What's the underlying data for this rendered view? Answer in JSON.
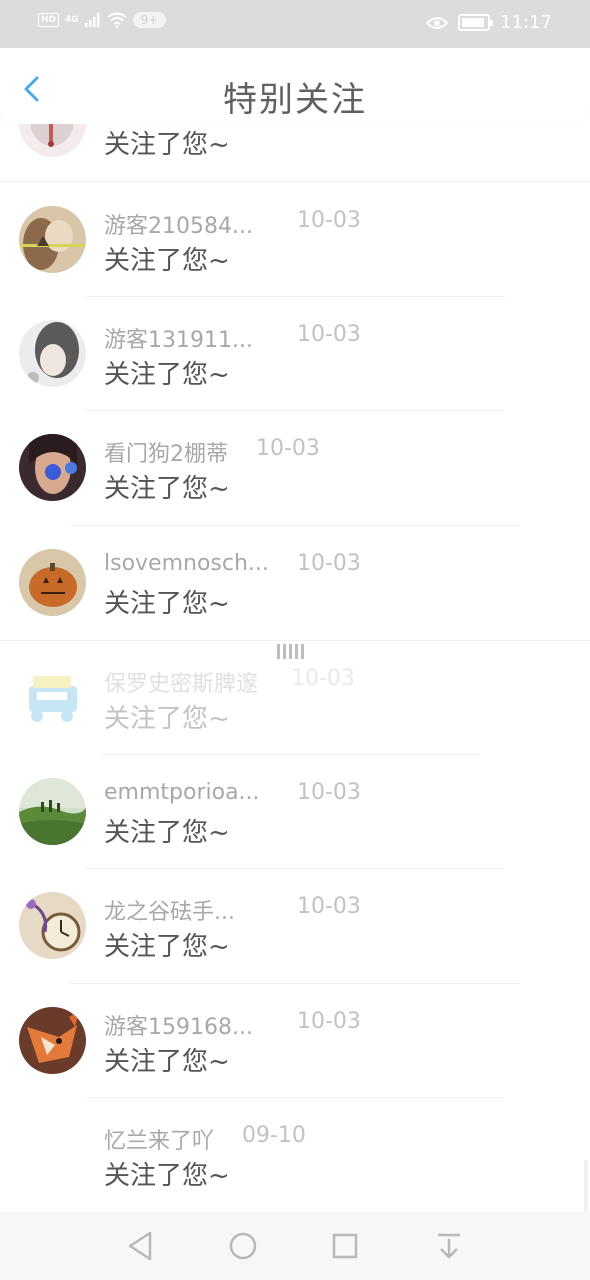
{
  "status_bar": {
    "hd": "HD",
    "network": "4G",
    "notification_count": "9+",
    "time": "11:17"
  },
  "header": {
    "title": "特别关注"
  },
  "list": {
    "items": [
      {
        "name": "",
        "date": "",
        "message": "关注了您~"
      },
      {
        "name": "游客210584...",
        "date": "10-03",
        "message": "关注了您~"
      },
      {
        "name": "游客131911...",
        "date": "10-03",
        "message": "关注了您~"
      },
      {
        "name": "看门狗2棚蒂",
        "date": "10-03",
        "message": "关注了您~"
      },
      {
        "name": "lsovemnosch...",
        "date": "10-03",
        "message": "关注了您~"
      },
      {
        "name": "保罗史密斯脾邃",
        "date": "10-03",
        "message": "关注了您~"
      },
      {
        "name": "emmtporioa...",
        "date": "10-03",
        "message": "关注了您~"
      },
      {
        "name": "龙之谷砝手...",
        "date": "10-03",
        "message": "关注了您~"
      },
      {
        "name": "游客159168...",
        "date": "10-03",
        "message": "关注了您~"
      },
      {
        "name": "忆兰来了吖",
        "date": "09-10",
        "message": "关注了您~"
      }
    ]
  },
  "colors": {
    "accent": "#4aa8e8",
    "status_bar_bg": "#dcdcdc",
    "name_text": "#a8a8a8",
    "date_text": "#c2c2c2",
    "message_text": "#555555"
  },
  "icons": {
    "back": "chevron-left-icon",
    "nav_back": "triangle-back-icon",
    "nav_home": "circle-home-icon",
    "nav_recent": "square-recent-icon",
    "nav_dropdown": "arrow-down-bar-icon"
  }
}
